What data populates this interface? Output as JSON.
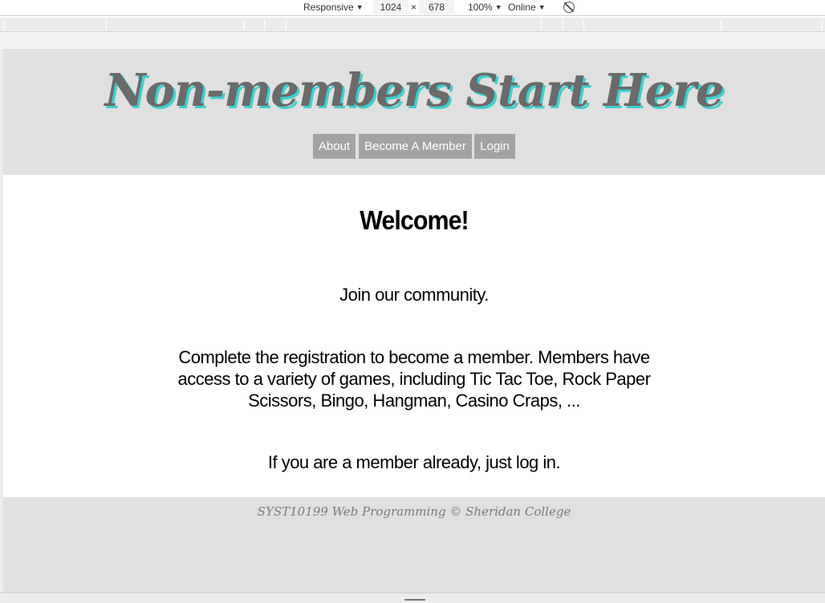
{
  "devtools": {
    "device_label": "Responsive",
    "width_value": "1024",
    "times": "×",
    "height_value": "678",
    "zoom_label": "100%",
    "throttle_label": "Online",
    "rotate_icon": "rotate-disabled-icon"
  },
  "site": {
    "title": "Non-members Start Here",
    "nav": {
      "about": "About",
      "become": "Become A Member",
      "login": "Login"
    },
    "content": {
      "heading": "Welcome!",
      "paragraph1": "Join our community.",
      "paragraph2": "Complete the registration to become a member. Members have access to a variety of games, including Tic Tac Toe, Rock Paper Scissors, Bingo, Hangman, Casino Craps, ...",
      "paragraph3": "If you are a member already, just log in."
    },
    "footer": "SYST10199 Web Programming © Sheridan College"
  },
  "colors": {
    "header_bg": "#e0e0e0",
    "nav_button_bg": "#a3a3a3",
    "title_color": "#6a6a6a",
    "title_shadow": "#3fd0d0"
  }
}
